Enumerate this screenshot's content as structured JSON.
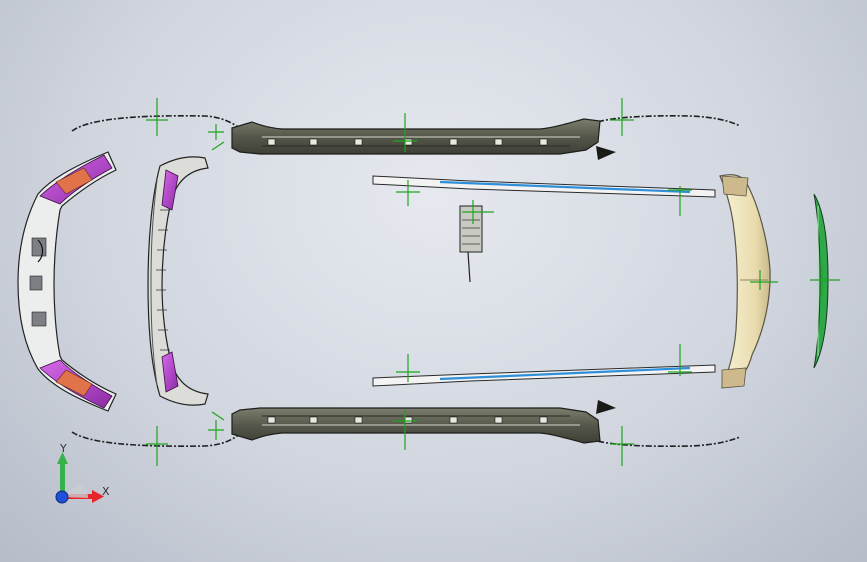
{
  "viewport": {
    "background_top": "#e6e9ef",
    "background_bottom": "#b6bcc8"
  },
  "colors": {
    "panel_body": "#5c5e50",
    "panel_edge": "#2b2c26",
    "sill_blue": "#2f8fd8",
    "sill_white": "#f2f2f2",
    "magenta_part": "#c24bd6",
    "orange_part": "#e0734a",
    "spoiler_cream": "#efe6bf",
    "lamp_green": "#2fa84a",
    "reference_axis_green": "#1ea51e",
    "triad_x_red": "#e8262a",
    "triad_y_green": "#37b24a",
    "triad_z_blue": "#2050d8"
  },
  "model_parts": [
    "front-bumper",
    "front-grille-panel",
    "left-side-skirt",
    "right-side-skirt",
    "left-door-sill-trim",
    "right-door-sill-trim",
    "rear-spoiler",
    "rear-lamp-strip",
    "center-bracket",
    "front-left-wheel-arch",
    "front-right-wheel-arch",
    "rear-left-wheel-arch",
    "rear-right-wheel-arch"
  ],
  "triad": {
    "x_label": "X",
    "y_label": "Y",
    "icons": [
      "x-axis-arrow-icon",
      "y-axis-arrow-icon",
      "z-axis-origin-icon"
    ]
  }
}
